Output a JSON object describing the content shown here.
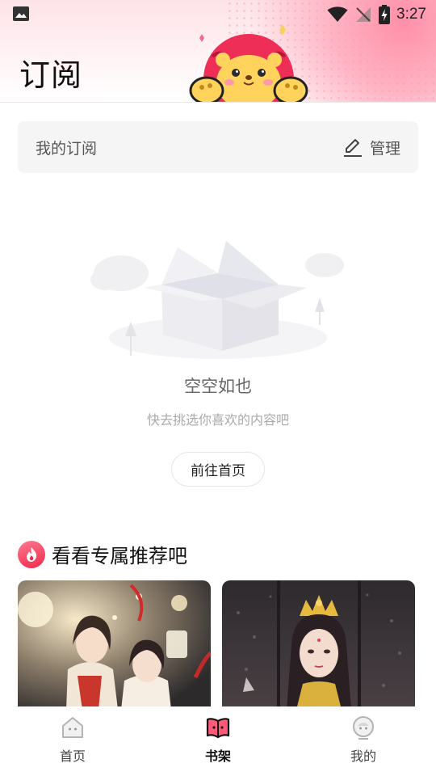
{
  "status_bar": {
    "time": "3:27"
  },
  "header": {
    "title": "订阅"
  },
  "subscription": {
    "label": "我的订阅",
    "manage_label": "管理"
  },
  "empty_state": {
    "title": "空空如也",
    "subtitle": "快去挑选你喜欢的内容吧",
    "button_label": "前往首页"
  },
  "recommend": {
    "title": "看看专属推荐吧",
    "cards": [
      {
        "art": "two-characters-lanterns"
      },
      {
        "art": "crowned-character-dark"
      }
    ]
  },
  "bottom_nav": {
    "items": [
      {
        "label": "首页",
        "icon": "home-icon",
        "active": false
      },
      {
        "label": "书架",
        "icon": "bookshelf-icon",
        "active": true
      },
      {
        "label": "我的",
        "icon": "profile-icon",
        "active": false
      }
    ]
  },
  "colors": {
    "accent": "#ee2a4a",
    "header_pink": "#fde3e8",
    "panel_gray": "#f5f5f5"
  }
}
